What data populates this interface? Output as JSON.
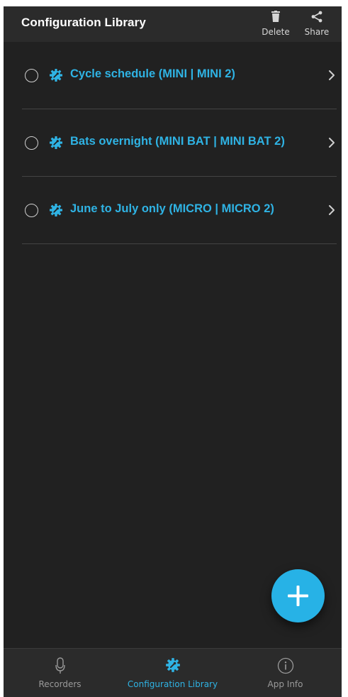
{
  "header": {
    "title": "Configuration Library",
    "delete_label": "Delete",
    "share_label": "Share"
  },
  "configurations": [
    {
      "title": "Cycle schedule (MINI | MINI 2)",
      "selected": false
    },
    {
      "title": "Bats overnight (MINI BAT | MINI BAT 2)",
      "selected": false
    },
    {
      "title": "June to July only (MICRO | MICRO 2)",
      "selected": false
    }
  ],
  "fab": {
    "icon": "plus-icon"
  },
  "bottom_nav": {
    "items": [
      {
        "label": "Recorders",
        "icon": "microphone-icon",
        "active": false
      },
      {
        "label": "Configuration Library",
        "icon": "config-gear-icon",
        "active": true
      },
      {
        "label": "App Info",
        "icon": "info-icon",
        "active": false
      }
    ]
  },
  "colors": {
    "accent": "#2fb3e4",
    "background": "#212121",
    "bar": "#2b2b2b",
    "fab": "#27b2e6"
  }
}
